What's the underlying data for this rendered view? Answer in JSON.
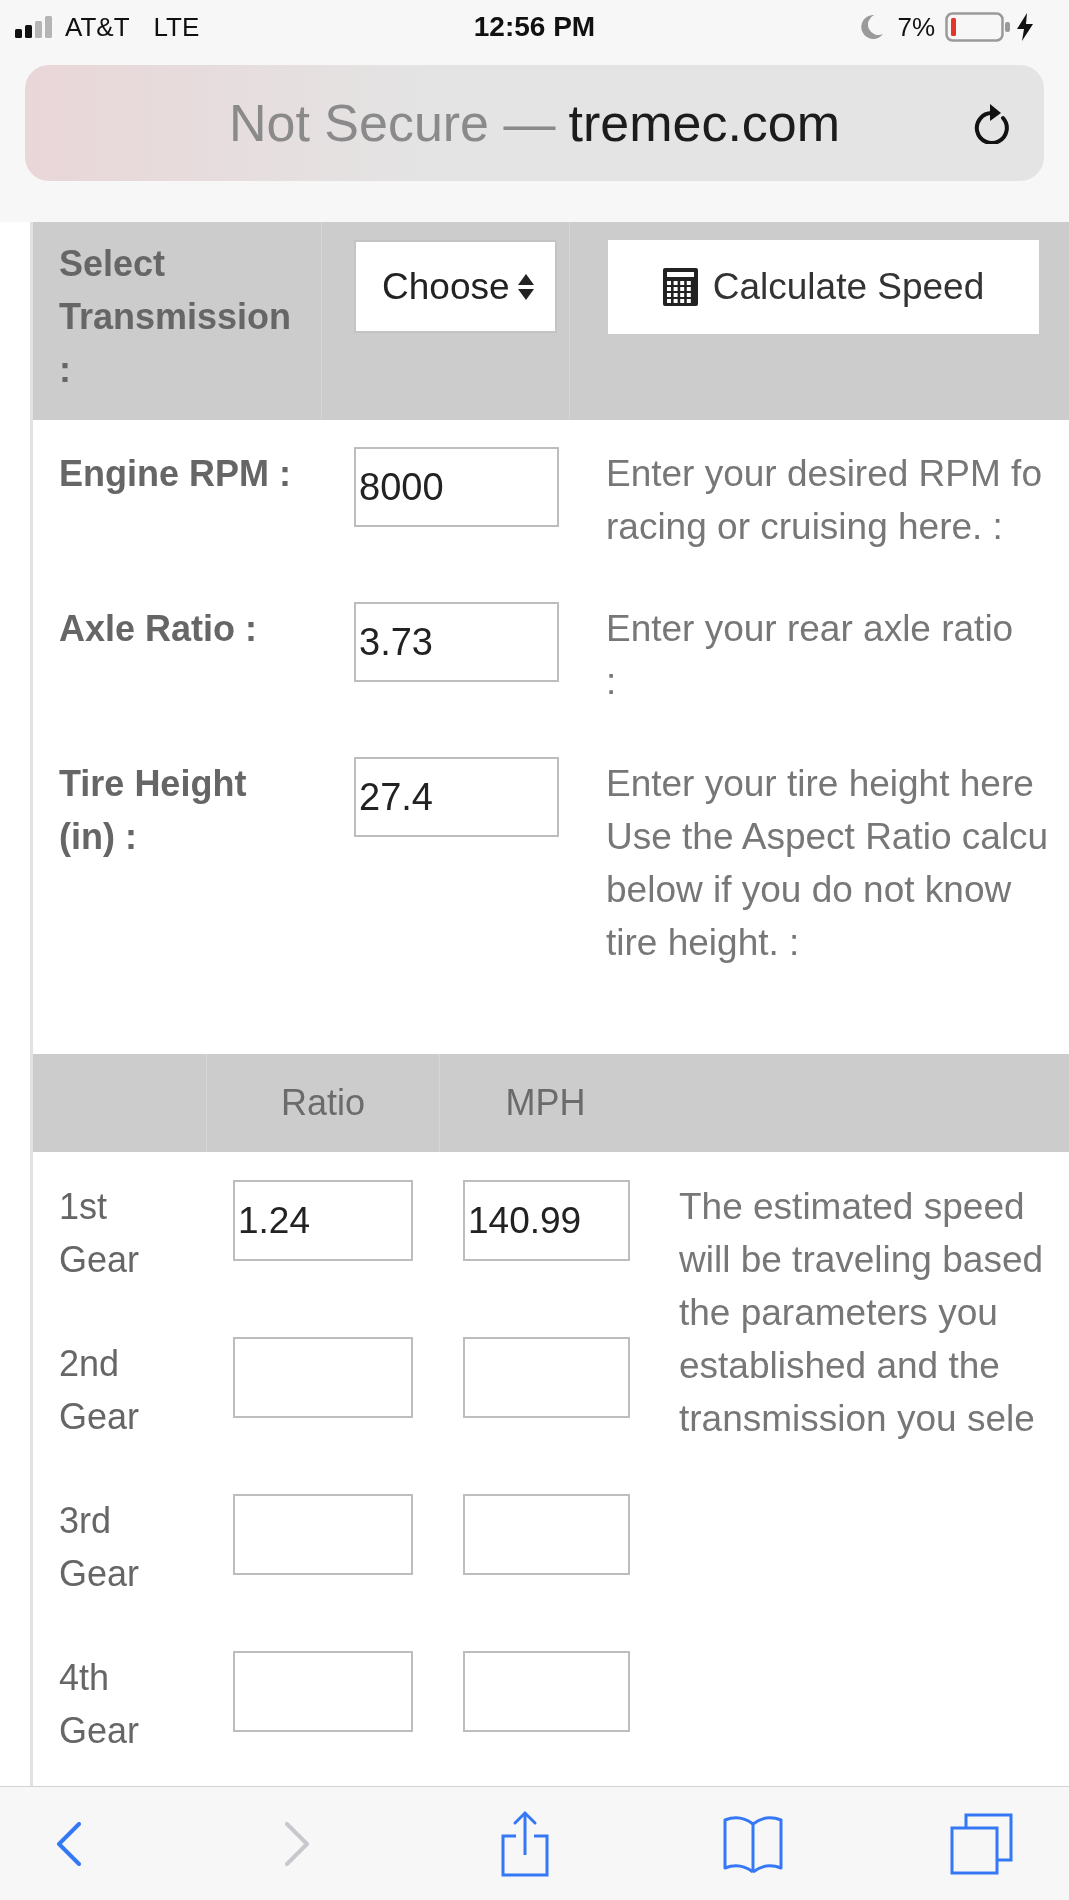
{
  "status_bar": {
    "carrier": "AT&T",
    "network": "LTE",
    "time": "12:56 PM",
    "battery": "7%"
  },
  "url_bar": {
    "security_text": "Not Secure —",
    "domain": "tremec.com"
  },
  "transmission_row": {
    "label_lines": [
      "Select",
      "Transmission",
      ":"
    ],
    "select": {
      "value": "Choose"
    },
    "button": {
      "label": "Calculate Speed"
    }
  },
  "parameters": [
    {
      "label_lines": [
        "Engine RPM :"
      ],
      "value": "8000",
      "hint_lines": [
        "Enter your desired RPM fo",
        "racing or cruising here. :"
      ]
    },
    {
      "label_lines": [
        "Axle Ratio :"
      ],
      "value": "3.73",
      "hint_lines": [
        "Enter your rear axle ratio",
        ":"
      ]
    },
    {
      "label_lines": [
        "Tire Height",
        "(in) :"
      ],
      "value": "27.4",
      "hint_lines": [
        "Enter your tire height here",
        "Use the Aspect Ratio calcu",
        "below if you do not know",
        "tire height. :"
      ]
    }
  ],
  "gear_table": {
    "columns": [
      "Ratio",
      "MPH"
    ],
    "rows": [
      {
        "label_lines": [
          "1st",
          "Gear"
        ],
        "ratio": "1.24",
        "mph": "140.99"
      },
      {
        "label_lines": [
          "2nd",
          "Gear"
        ]
      },
      {
        "label_lines": [
          "3rd",
          "Gear"
        ]
      },
      {
        "label_lines": [
          "4th",
          "Gear"
        ]
      }
    ],
    "note_lines": [
      "The estimated speed",
      "will be traveling based",
      "the parameters you",
      "established and the",
      "transmission you sele"
    ]
  },
  "toolbar": {
    "items": [
      {
        "kind": "back",
        "disabled": false
      },
      {
        "kind": "forward",
        "disabled": true
      },
      {
        "kind": "share",
        "disabled": false
      },
      {
        "kind": "bookmarks",
        "disabled": false
      },
      {
        "kind": "tabs",
        "disabled": false
      }
    ]
  }
}
